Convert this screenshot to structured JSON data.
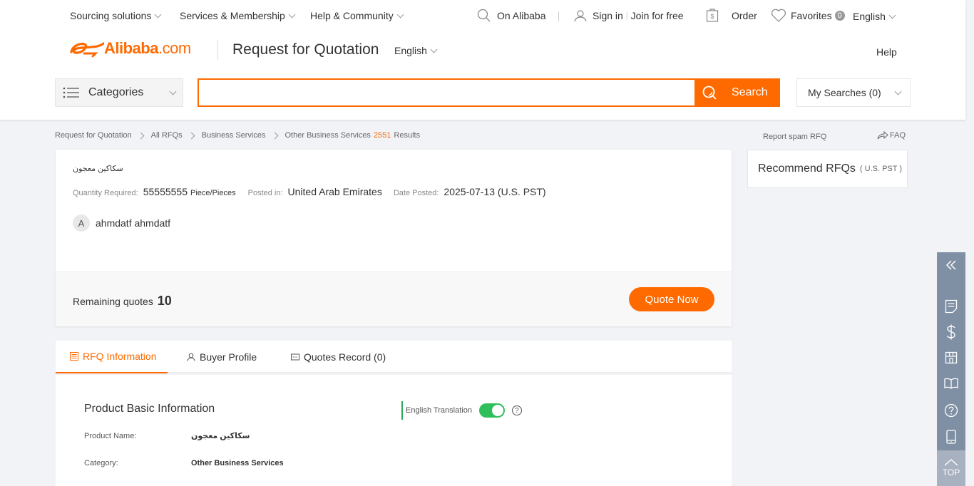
{
  "topbar": {
    "sourcing": "Sourcing solutions",
    "services": "Services & Membership",
    "help_community": "Help & Community",
    "on_alibaba": "On Alibaba",
    "sign_in": "Sign in",
    "join": "Join for free",
    "order": "Order",
    "favorites": "Favorites",
    "favorites_count": "0",
    "language": "English"
  },
  "header": {
    "logo_main": "Alibaba",
    "logo_suffix": ".com",
    "title": "Request for Quotation",
    "language": "English",
    "help": "Help"
  },
  "searchbar": {
    "categories": "Categories",
    "placeholder": "",
    "search_label": "Search",
    "my_searches": "My Searches (0)"
  },
  "breadcrumb": {
    "items": [
      "Request for Quotation",
      "All RFQs",
      "Business Services",
      "Other Business Services"
    ],
    "count": "2551",
    "results_label": "Results"
  },
  "rfq": {
    "name": "سكاكين معجون",
    "quantity_label": "Quantity Required:",
    "quantity_value": "55555555",
    "quantity_unit": "Piece/Pieces",
    "posted_label": "Posted in:",
    "posted_value": "United Arab Emirates",
    "date_label": "Date Posted:",
    "date_value": "2025-07-13 (U.S. PST)",
    "buyer_initial": "A",
    "buyer_name": "ahmdatf ahmdatf",
    "remaining_label": "Remaining quotes",
    "remaining_count": "10",
    "quote_button": "Quote Now"
  },
  "tabs": [
    {
      "label": "RFQ Information",
      "active": true
    },
    {
      "label": "Buyer Profile",
      "active": false
    },
    {
      "label": "Quotes Record (0)",
      "active": false
    }
  ],
  "details": {
    "section_title": "Product Basic Information",
    "translation_label": "English Translation",
    "translation_on": true,
    "help_mark": "?",
    "rows": [
      {
        "label": "Product Name:",
        "value": "سكاكين معجون"
      },
      {
        "label": "Category:",
        "value": "Other Business Services"
      }
    ]
  },
  "right_panel": {
    "report": "Report spam RFQ",
    "faq": "FAQ",
    "recommend_title": "Recommend RFQs",
    "recommend_sub": "( U.S. PST )"
  },
  "side_toolbar": {
    "top_label": "TOP"
  },
  "colors": {
    "accent": "#ff6a00",
    "toggle": "#2fbf5a",
    "sidebar": "#7f8fa4"
  }
}
